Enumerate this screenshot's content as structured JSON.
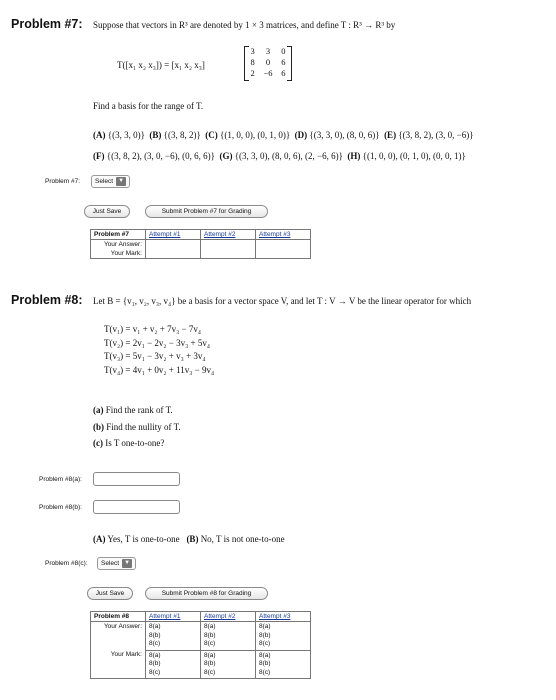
{
  "p7": {
    "title": "Problem #7:",
    "intro": "Suppose that vectors in R³ are denoted by 1 × 3 matrices, and define T : R³ → R³ by",
    "lhs": "T([x₁ x₂ x₃]) = [x₁ x₂ x₃]",
    "matrix": [
      [
        "3",
        "3",
        "0"
      ],
      [
        "8",
        "0",
        "6"
      ],
      [
        "2",
        "−6",
        "6"
      ]
    ],
    "question": "Find a basis for the range of T.",
    "choices_line1": [
      {
        "key": "(A)",
        "text": "{(3, 3, 0)}"
      },
      {
        "key": "(B)",
        "text": "{(3, 8, 2)}"
      },
      {
        "key": "(C)",
        "text": "{(1, 0, 0), (0, 1, 0)}"
      },
      {
        "key": "(D)",
        "text": "{(3, 3, 0), (8, 0, 6)}"
      },
      {
        "key": "(E)",
        "text": "{(3, 8, 2), (3, 0, −6)}"
      }
    ],
    "choices_line2": [
      {
        "key": "(F)",
        "text": "{(3, 8, 2), (3, 0, −6), (0, 6, 6)}"
      },
      {
        "key": "(G)",
        "text": "{(3, 3, 0), (8, 0, 6), (2, −6, 6)}"
      },
      {
        "key": "(H)",
        "text": "{(1, 0, 0), (0, 1, 0), (0, 0, 1)}"
      }
    ],
    "answer_label": "Problem #7:",
    "select_value": "Select",
    "just_save": "Just Save",
    "submit": "Submit Problem #7 for Grading",
    "table": {
      "header": "Problem #7",
      "attempts": [
        "Attempt #1",
        "Attempt #2",
        "Attempt #3"
      ],
      "row1": "Your Answer:",
      "row2": "Your Mark:"
    }
  },
  "p8": {
    "title": "Problem #8:",
    "intro": "Let B = {v₁, v₂, v₃, v₄} be a basis for a vector space V, and let T : V → V be the linear operator for which",
    "equations": [
      "T(v₁) = v₁ + v₂ + 7v₃ − 7v₄",
      "T(v₂) = 2v₁ − 2v₂ − 3v₃ + 5v₄",
      "T(v₃) = 5v₁ − 3v₂ + v₃ + 3v₄",
      "T(v₄) = 4v₁ + 0v₂ + 11v₃ − 9v₄"
    ],
    "parts": [
      {
        "key": "(a)",
        "text": "Find the rank of T."
      },
      {
        "key": "(b)",
        "text": "Find the nullity of T."
      },
      {
        "key": "(c)",
        "text": "Is T one-to-one?"
      }
    ],
    "label_a": "Problem #8(a):",
    "label_b": "Problem #8(b):",
    "value_a": "",
    "value_b": "",
    "choices": [
      {
        "key": "(A)",
        "text": "Yes, T is one-to-one"
      },
      {
        "key": "(B)",
        "text": "No, T is not one-to-one"
      }
    ],
    "label_c": "Problem #8(c):",
    "select_value": "Select",
    "just_save": "Just Save",
    "submit": "Submit Problem #8 for Grading",
    "table": {
      "header": "Problem #8",
      "attempts": [
        "Attempt #1",
        "Attempt #2",
        "Attempt #3"
      ],
      "row1": "Your Answer:",
      "row2": "Your Mark:",
      "sub": [
        "8(a)",
        "8(b)",
        "8(c)"
      ]
    }
  },
  "icons": {
    "dropdown": "dropdown-arrow-icon"
  }
}
